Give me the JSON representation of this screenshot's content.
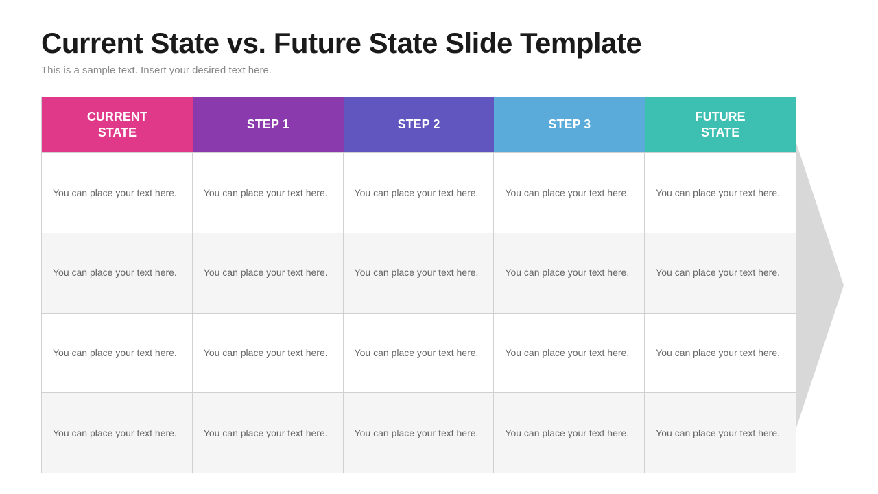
{
  "page": {
    "title": "Current State vs. Future State Slide Template",
    "subtitle": "This is a sample text. Insert your desired text here."
  },
  "table": {
    "headers": [
      {
        "id": "current-state",
        "label": "CURRENT\nSTATE",
        "color_class": "current-state"
      },
      {
        "id": "step1",
        "label": "STEP 1",
        "color_class": "step1"
      },
      {
        "id": "step2",
        "label": "STEP 2",
        "color_class": "step2"
      },
      {
        "id": "step3",
        "label": "STEP 3",
        "color_class": "step3"
      },
      {
        "id": "future-state",
        "label": "FUTURE\nSTATE",
        "color_class": "future-state"
      }
    ],
    "rows": [
      {
        "cells": [
          "You can place your text here.",
          "You can place your text here.",
          "You can place your text here.",
          "You can place your text here.",
          "You can place your text here."
        ]
      },
      {
        "cells": [
          "You can place your text here.",
          "You can place your text here.",
          "You can place your text here.",
          "You can place your text here.",
          "You can place your text here."
        ]
      },
      {
        "cells": [
          "You can place your text here.",
          "You can place your text here.",
          "You can place your text here.",
          "You can place your text here.",
          "You can place your text here."
        ]
      },
      {
        "cells": [
          "You can place your text here.",
          "You can place your text here.",
          "You can place your text here.",
          "You can place your text here.",
          "You can place your text here."
        ]
      }
    ]
  }
}
